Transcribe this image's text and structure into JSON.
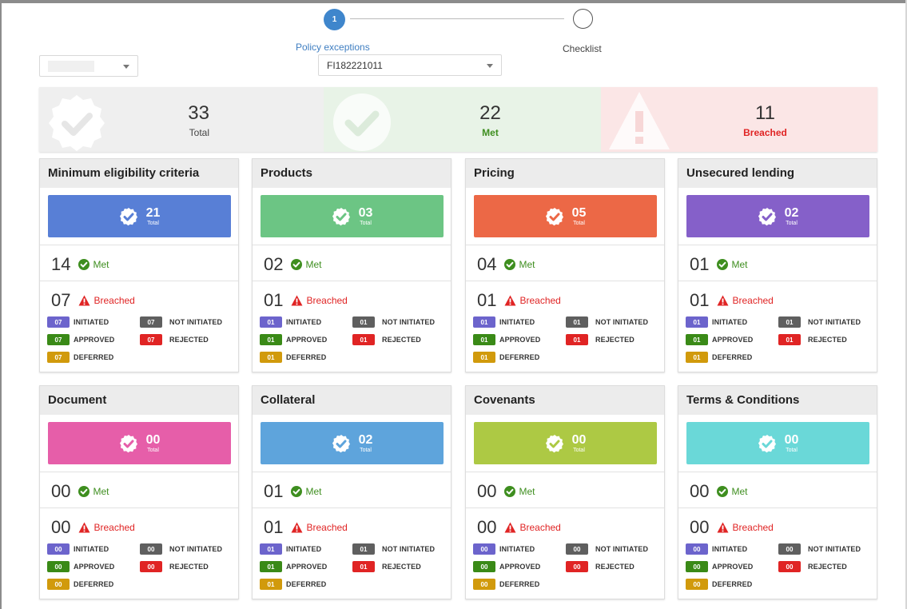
{
  "stepper": {
    "step1_number": "1",
    "step1_label": "Policy exceptions",
    "step2_label": "Checklist"
  },
  "filters": {
    "left_select_value": "",
    "main_select_value": "FI182221011"
  },
  "summary": {
    "total_value": "33",
    "total_label": "Total",
    "met_value": "22",
    "met_label": "Met",
    "breached_value": "11",
    "breached_label": "Breached"
  },
  "labels": {
    "tile_total": "Total",
    "met": "Met",
    "breached": "Breached",
    "initiated": "INITIATED",
    "not_initiated": "NOT INITIATED",
    "approved": "APPROVED",
    "rejected": "REJECTED",
    "deferred": "DEFERRED"
  },
  "colors": {
    "initiated": "#6c64cc",
    "not_initiated": "#5f5f5f",
    "approved": "#3a8a17",
    "rejected": "#e02424",
    "deferred": "#d19a0c",
    "met_green": "#3e8e1f",
    "breach_red": "#e02424"
  },
  "cards": [
    {
      "name": "minimum-eligibility-criteria",
      "title": "Minimum eligibility criteria",
      "color": "#587fd6",
      "total": "21",
      "met": "14",
      "breached": "07",
      "initiated": "07",
      "not_initiated": "07",
      "approved": "07",
      "rejected": "07",
      "deferred": "07"
    },
    {
      "name": "products",
      "title": "Products",
      "color": "#6cc584",
      "total": "03",
      "met": "02",
      "breached": "01",
      "initiated": "01",
      "not_initiated": "01",
      "approved": "01",
      "rejected": "01",
      "deferred": "01"
    },
    {
      "name": "pricing",
      "title": "Pricing",
      "color": "#ec6846",
      "total": "05",
      "met": "04",
      "breached": "01",
      "initiated": "01",
      "not_initiated": "01",
      "approved": "01",
      "rejected": "01",
      "deferred": "01"
    },
    {
      "name": "unsecured-lending",
      "title": "Unsecured lending",
      "color": "#8560c9",
      "total": "02",
      "met": "01",
      "breached": "01",
      "initiated": "01",
      "not_initiated": "01",
      "approved": "01",
      "rejected": "01",
      "deferred": "01"
    },
    {
      "name": "document",
      "title": "Document",
      "color": "#e65ea9",
      "total": "00",
      "met": "00",
      "breached": "00",
      "initiated": "00",
      "not_initiated": "00",
      "approved": "00",
      "rejected": "00",
      "deferred": "00"
    },
    {
      "name": "collateral",
      "title": "Collateral",
      "color": "#5ea4dc",
      "total": "02",
      "met": "01",
      "breached": "01",
      "initiated": "01",
      "not_initiated": "01",
      "approved": "01",
      "rejected": "01",
      "deferred": "01"
    },
    {
      "name": "covenants",
      "title": "Covenants",
      "color": "#adc944",
      "total": "00",
      "met": "00",
      "breached": "00",
      "initiated": "00",
      "not_initiated": "00",
      "approved": "00",
      "rejected": "00",
      "deferred": "00"
    },
    {
      "name": "terms-and-conditions",
      "title": "Terms & Conditions",
      "color": "#6ad8d8",
      "total": "00",
      "met": "00",
      "breached": "00",
      "initiated": "00",
      "not_initiated": "00",
      "approved": "00",
      "rejected": "00",
      "deferred": "00"
    }
  ]
}
